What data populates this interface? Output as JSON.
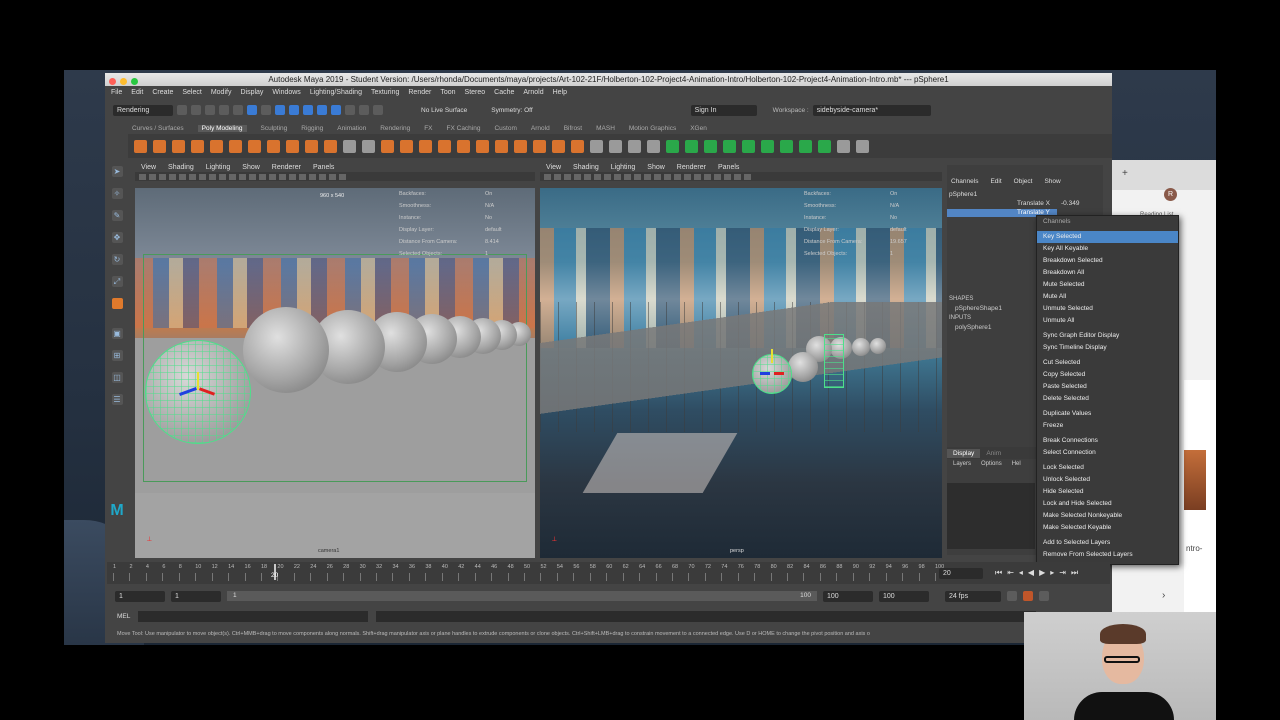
{
  "window": {
    "title": "Autodesk Maya 2019 - Student Version: /Users/rhonda/Documents/maya/projects/Art-102-21F/Holberton-102-Project4-Animation-Intro/Holberton-102-Project4-Animation-Intro.mb*  ---  pSphere1"
  },
  "menubar": [
    "File",
    "Edit",
    "Create",
    "Select",
    "Modify",
    "Display",
    "Windows",
    "Lighting/Shading",
    "Texturing",
    "Render",
    "Toon",
    "Stereo",
    "Cache",
    "Arnold",
    "Help"
  ],
  "statusline": {
    "menuset": "Rendering",
    "live_surface": "No Live Surface",
    "symmetry": "Symmetry: Off",
    "sign_in": "Sign In",
    "workspace_label": "Workspace :",
    "workspace": "sidebyside-camera*"
  },
  "shelf_tabs": [
    "Curves / Surfaces",
    "Poly Modeling",
    "Sculpting",
    "Rigging",
    "Animation",
    "Rendering",
    "FX",
    "FX Caching",
    "Custom",
    "Arnold",
    "Bifrost",
    "MASH",
    "Motion Graphics",
    "XGen"
  ],
  "shelf_active": "Poly Modeling",
  "viewport_menu": [
    "View",
    "Shading",
    "Lighting",
    "Show",
    "Renderer",
    "Panels"
  ],
  "viewport_left": {
    "camera": "camera1",
    "resolution": "960 x 540",
    "hud": [
      {
        "k": "Backfaces:",
        "v": "On"
      },
      {
        "k": "Smoothness:",
        "v": "N/A"
      },
      {
        "k": "Instance:",
        "v": "No"
      },
      {
        "k": "Display Layer:",
        "v": "default"
      },
      {
        "k": "Distance From Camera:",
        "v": "8.414"
      },
      {
        "k": "Selected Objects:",
        "v": "1"
      }
    ]
  },
  "viewport_right": {
    "camera": "persp",
    "hud": [
      {
        "k": "Backfaces:",
        "v": "On"
      },
      {
        "k": "Smoothness:",
        "v": "N/A"
      },
      {
        "k": "Instance:",
        "v": "No"
      },
      {
        "k": "Display Layer:",
        "v": "default"
      },
      {
        "k": "Distance From Camera:",
        "v": "19.657"
      },
      {
        "k": "Selected Objects:",
        "v": "1"
      }
    ]
  },
  "channelbox": {
    "tabs": [
      "Channels",
      "Edit",
      "Object",
      "Show"
    ],
    "object": "pSphere1",
    "attr1": "Translate X",
    "attr1_value": "-0.349",
    "attr2": "Translate Y",
    "shapes_label": "SHAPES",
    "shape": "pSphereShape1",
    "inputs_label": "INPUTS",
    "input": "polySphere1",
    "layer_tabs": [
      "Display",
      "Anim"
    ],
    "layer_menu": [
      "Layers",
      "Options",
      "Hel"
    ]
  },
  "context_menu": {
    "header": "Channels",
    "items": [
      "Key Selected",
      "Key All Keyable",
      "Breakdown Selected",
      "Breakdown All",
      "Mute Selected",
      "Mute All",
      "Unmute Selected",
      "Unmute All",
      "|",
      "Sync Graph Editor Display",
      "Sync Timeline Display",
      "|",
      "Cut Selected",
      "Copy Selected",
      "Paste Selected",
      "Delete Selected",
      "|",
      "Duplicate Values",
      "Freeze",
      "|",
      "Break Connections",
      "Select Connection",
      "|",
      "Lock Selected",
      "Unlock Selected",
      "Hide Selected",
      "Lock and Hide Selected",
      "Make Selected Nonkeyable",
      "Make Selected Keyable",
      "|",
      "Add to Selected Layers",
      "Remove From Selected Layers"
    ],
    "highlighted": "Key Selected"
  },
  "timeline": {
    "ticks": [
      "1",
      "2",
      "4",
      "6",
      "8",
      "10",
      "12",
      "14",
      "16",
      "18",
      "20",
      "22",
      "24",
      "26",
      "28",
      "30",
      "32",
      "34",
      "36",
      "38",
      "40",
      "42",
      "44",
      "46",
      "48",
      "50",
      "52",
      "54",
      "56",
      "58",
      "60",
      "62",
      "64",
      "66",
      "68",
      "70",
      "72",
      "74",
      "76",
      "78",
      "80",
      "82",
      "84",
      "86",
      "88",
      "90",
      "92",
      "94",
      "96",
      "98",
      "100"
    ],
    "current_frame": "20",
    "current_frame_field": "20"
  },
  "range": {
    "start": "1",
    "start2": "1",
    "slider_start": "1",
    "slider_end": "100",
    "end": "100",
    "end2": "100",
    "fps": "24 fps"
  },
  "mel_label": "MEL",
  "help_line": "Move Tool: Use manipulator to move object(s). Ctrl+MMB+drag to move components along normals. Shift+drag manipulator axis or plane handles to extrude components or clone objects. Ctrl+Shift+LMB+drag to constrain movement to a connected edge. Use D or HOME to change the pivot position and axis o",
  "browser_partial": {
    "reading_list": "Reading List",
    "avatar_letter": "R",
    "snippet": "ntro-"
  },
  "colors": {
    "accent": "#4a86c7",
    "wire_green": "#4de08a",
    "shelf_orange": "#d9732e"
  }
}
